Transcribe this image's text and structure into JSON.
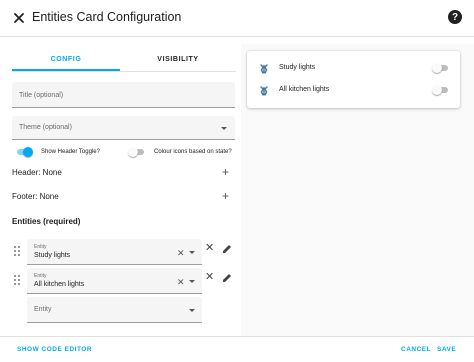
{
  "dialog": {
    "title": "Entities Card Configuration",
    "help_symbol": "?"
  },
  "tabs": [
    {
      "label": "CONFIG",
      "active": true
    },
    {
      "label": "VISIBILITY",
      "active": false
    }
  ],
  "form": {
    "title_field": {
      "placeholder": "Title (optional)",
      "value": ""
    },
    "theme_field": {
      "placeholder": "Theme (optional)",
      "value": ""
    },
    "show_header_toggle": {
      "label": "Show Header Toggle?",
      "on": true
    },
    "state_color_toggle": {
      "label": "Colour icons based on state?",
      "on": false
    },
    "header_row": {
      "label": "Header: None"
    },
    "footer_row": {
      "label": "Footer: None"
    },
    "entities_title": "Entities (required)",
    "entities": [
      {
        "label": "Entity",
        "value": "Study lights"
      },
      {
        "label": "Entity",
        "value": "All kitchen lights"
      }
    ],
    "new_entity": {
      "placeholder": "Entity"
    }
  },
  "footer": {
    "show_code_editor": "SHOW CODE EDITOR",
    "cancel": "CANCEL",
    "save": "SAVE"
  },
  "preview": {
    "rows": [
      {
        "name": "Study lights",
        "on": false
      },
      {
        "name": "All kitchen lights",
        "on": false
      }
    ]
  },
  "colors": {
    "accent": "#03a9f4",
    "icon_blue": "#44739e"
  },
  "icons": [
    "close-icon",
    "help-icon",
    "plus-icon",
    "drag-handle-icon",
    "clear-icon",
    "chevron-down-icon",
    "remove-icon",
    "pencil-icon",
    "lightbulb-icon"
  ]
}
